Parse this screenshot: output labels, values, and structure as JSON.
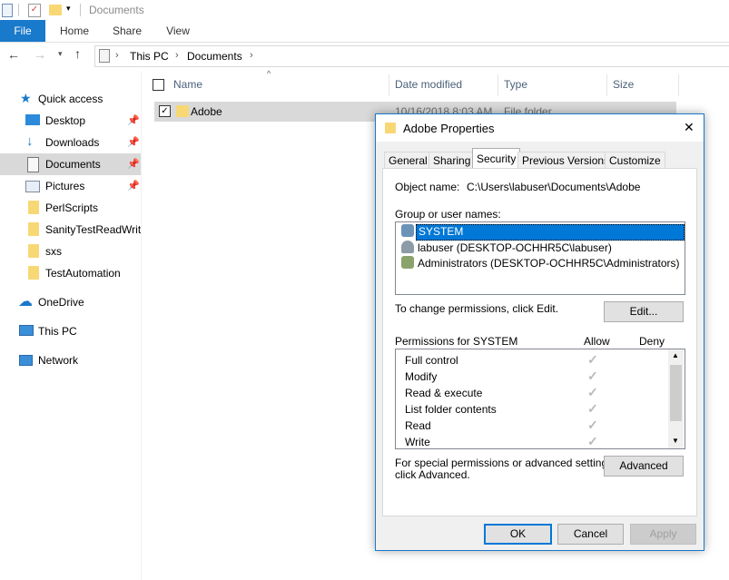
{
  "window": {
    "title": "Documents"
  },
  "ribbon": {
    "tabs": [
      "File",
      "Home",
      "Share",
      "View"
    ]
  },
  "address": {
    "crumbs": [
      "This PC",
      "Documents"
    ]
  },
  "nav": {
    "quick_access": "Quick access",
    "items": [
      {
        "label": "Desktop",
        "icon": "desktop-icon",
        "pinned": true
      },
      {
        "label": "Downloads",
        "icon": "downloads-icon",
        "pinned": true
      },
      {
        "label": "Documents",
        "icon": "documents-icon",
        "pinned": true,
        "selected": true
      },
      {
        "label": "Pictures",
        "icon": "pictures-icon",
        "pinned": true
      },
      {
        "label": "PerlScripts",
        "icon": "folder-icon"
      },
      {
        "label": "SanityTestReadWrite",
        "icon": "folder-icon"
      },
      {
        "label": "sxs",
        "icon": "folder-icon"
      },
      {
        "label": "TestAutomation",
        "icon": "folder-icon"
      }
    ],
    "onedrive": "OneDrive",
    "thispc": "This PC",
    "network": "Network"
  },
  "filelist": {
    "columns": [
      "Name",
      "Date modified",
      "Type",
      "Size"
    ],
    "rows": [
      {
        "name": "Adobe",
        "date": "10/16/2018 8:03 AM",
        "type": "File folder",
        "size": ""
      }
    ]
  },
  "dialog": {
    "title": "Adobe Properties",
    "tabs": [
      "General",
      "Sharing",
      "Security",
      "Previous Versions",
      "Customize"
    ],
    "active_tab": "Security",
    "object_name_label": "Object name:",
    "object_name_value": "C:\\Users\\labuser\\Documents\\Adobe",
    "group_label": "Group or user names:",
    "users": [
      "SYSTEM",
      "labuser (DESKTOP-OCHHR5C\\labuser)",
      "Administrators (DESKTOP-OCHHR5C\\Administrators)"
    ],
    "change_text": "To change permissions, click Edit.",
    "edit_button": "Edit...",
    "perm_header": "Permissions for SYSTEM",
    "allow": "Allow",
    "deny": "Deny",
    "permissions": [
      {
        "name": "Full control",
        "allow": true
      },
      {
        "name": "Modify",
        "allow": true
      },
      {
        "name": "Read & execute",
        "allow": true
      },
      {
        "name": "List folder contents",
        "allow": true
      },
      {
        "name": "Read",
        "allow": true
      },
      {
        "name": "Write",
        "allow": true
      }
    ],
    "special_text_1": "For special permissions or advanced settings,",
    "special_text_2": "click Advanced.",
    "advanced_button": "Advanced",
    "ok": "OK",
    "cancel": "Cancel",
    "apply": "Apply",
    "close_glyph": "✕",
    "check_glyph": "✓",
    "scroll_up_glyph": "▲",
    "scroll_down_glyph": "▼"
  },
  "colors": {
    "accent": "#1979ca",
    "selection": "#0078d7",
    "folder": "#f8d775"
  }
}
